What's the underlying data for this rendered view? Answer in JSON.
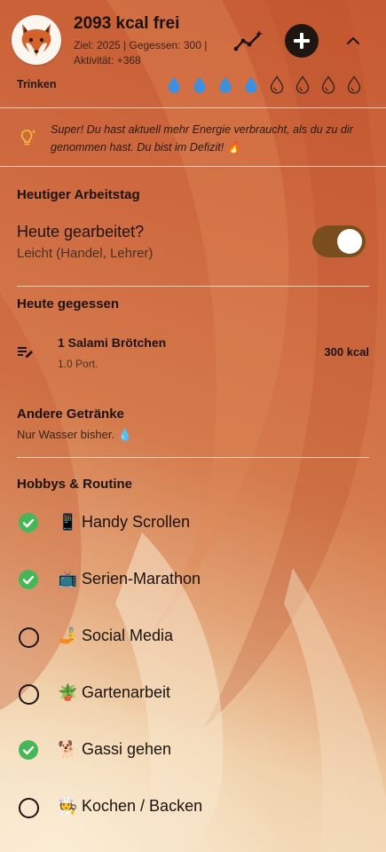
{
  "header": {
    "kcal_title": "2093 kcal frei",
    "meta_line1": "Ziel: 2025 | Gegessen: 300 |",
    "meta_line2": "Aktivität: +368",
    "icons": {
      "avatar": "fox-avatar",
      "trend": "trend-icon",
      "add": "plus-icon",
      "collapse": "chevron-up-icon"
    }
  },
  "drinks_tracker": {
    "label": "Trinken",
    "filled": 4,
    "total": 8,
    "filled_color": "#3d8fe0"
  },
  "tip": {
    "icon": "lightbulb-icon",
    "text": "Super! Du hast aktuell mehr Energie verbraucht, als du zu dir genommen hast. Du bist im Defizit! 🔥"
  },
  "work": {
    "section_title": "Heutiger Arbeitstag",
    "question": "Heute gearbeitet?",
    "level": "Leicht (Handel, Lehrer)",
    "toggle_on": true
  },
  "eaten": {
    "section_title": "Heute gegessen",
    "items": [
      {
        "name": "1 Salami Brötchen",
        "portion": "1.0 Port.",
        "kcal": "300 kcal"
      }
    ]
  },
  "other_drinks": {
    "section_title": "Andere Getränke",
    "text": "Nur Wasser bisher. 💧"
  },
  "hobbies": {
    "section_title": "Hobbys & Routine",
    "items": [
      {
        "emoji": "📱",
        "label": "Handy Scrollen",
        "done": true
      },
      {
        "emoji": "📺",
        "label": "Serien-Marathon",
        "done": true
      },
      {
        "emoji": "🤳",
        "label": "Social Media",
        "done": false
      },
      {
        "emoji": "🪴",
        "label": "Gartenarbeit",
        "done": false
      },
      {
        "emoji": "🐕",
        "label": "Gassi gehen",
        "done": true
      },
      {
        "emoji": "🧑‍🍳",
        "label": "Kochen / Backen",
        "done": false
      }
    ]
  },
  "colors": {
    "accent_dark": "#1f1611",
    "toggle_track": "#7a4d1e",
    "check_green": "#47b657",
    "tip_icon": "#f0b63a"
  }
}
